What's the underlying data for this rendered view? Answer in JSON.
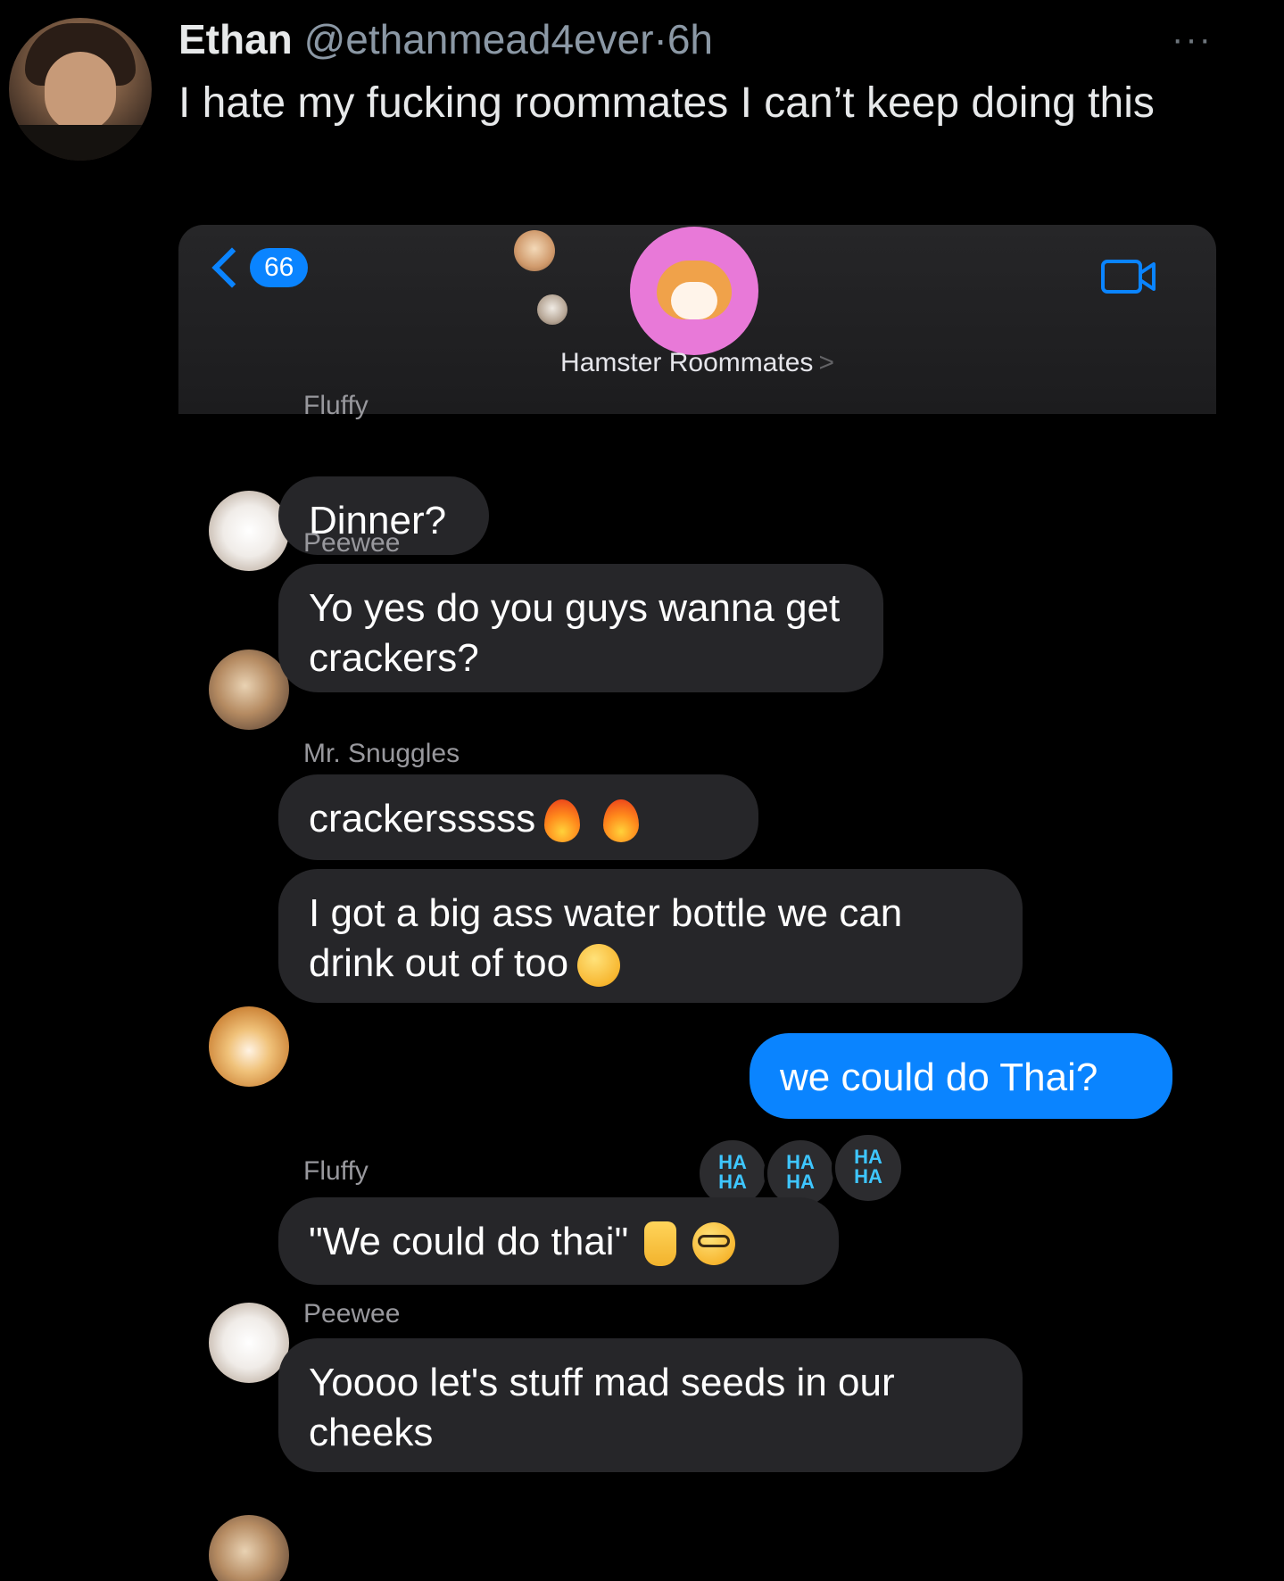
{
  "tweet": {
    "name": "Ethan",
    "handle": "@ethanmead4ever",
    "separator": "·",
    "time": "6h",
    "more_label": "···",
    "text": "I hate my fucking roommates I can’t keep doing this"
  },
  "chat": {
    "back_count": "66",
    "group_name": "Hamster Roommates",
    "group_chevron": ">",
    "messages": [
      {
        "sender": "Fluffy",
        "text": "Dinner?"
      },
      {
        "sender": "Peewee",
        "text": "Yo yes do you guys wanna get crackers?"
      },
      {
        "sender": "Mr. Snuggles",
        "text": "crackersssss",
        "emoji": [
          "fire",
          "fire"
        ]
      },
      {
        "sender": "",
        "text": "I got a big ass water bottle we can drink out of too",
        "emoji": [
          "smirking-face"
        ]
      },
      {
        "sender": "me",
        "text": "we could do Thai?"
      },
      {
        "sender": "Fluffy",
        "text": "\"We could do thai\"",
        "emoji": [
          "index-pointing-up",
          "nerd-face"
        ]
      },
      {
        "sender": "Peewee",
        "text": "Yoooo let's stuff mad seeds in our cheeks"
      }
    ],
    "tapback": {
      "line1": "HA",
      "line2": "HA",
      "count": 3
    }
  },
  "colors": {
    "imessage_blue": "#0a84ff",
    "bubble_gray": "#262629",
    "group_avatar_pink": "#e879d8",
    "tapback_text": "#3ec6ff"
  },
  "icons": [
    "back-chevron-icon",
    "video-call-icon",
    "fire-icon",
    "smirking-face-icon",
    "index-pointing-up-icon",
    "nerd-face-icon",
    "haha-tapback-icon"
  ]
}
